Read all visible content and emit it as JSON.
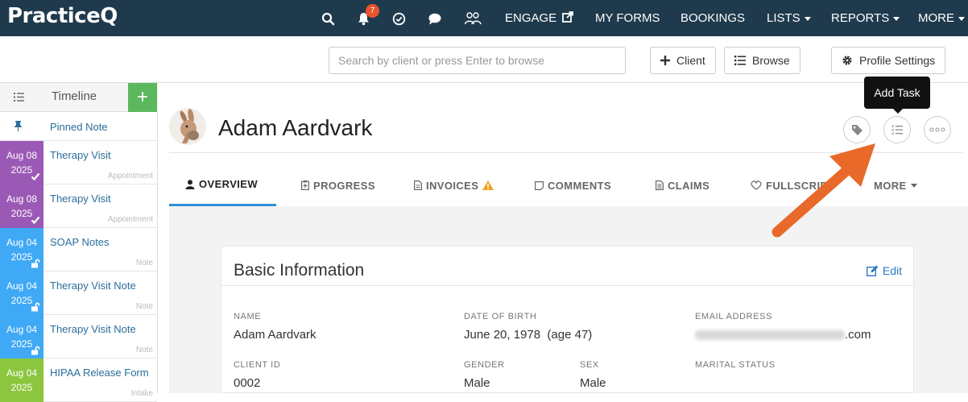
{
  "app": {
    "logo": "PracticeQ"
  },
  "topnav": {
    "notification_count": "7",
    "links": [
      {
        "label": "ENGAGE"
      },
      {
        "label": "MY FORMS"
      },
      {
        "label": "BOOKINGS"
      },
      {
        "label": "LISTS"
      },
      {
        "label": "REPORTS"
      },
      {
        "label": "MORE"
      }
    ]
  },
  "toolbar": {
    "search_placeholder": "Search by client or press Enter to browse",
    "client_button": "Client",
    "browse_button": "Browse",
    "profile_settings_button": "Profile Settings"
  },
  "timeline": {
    "title": "Timeline",
    "pinned": "Pinned Note",
    "items": [
      {
        "month": "Aug 08",
        "year": "2025",
        "label": "Therapy Visit",
        "type": "Appointment",
        "color": "#9b59b6",
        "mark": "check"
      },
      {
        "month": "Aug 08",
        "year": "2025",
        "label": "Therapy Visit",
        "type": "Appointment",
        "color": "#9b59b6",
        "mark": "check"
      },
      {
        "month": "Aug 04",
        "year": "2025",
        "label": "SOAP Notes",
        "type": "Note",
        "color": "#3fa9f5",
        "mark": "unlock"
      },
      {
        "month": "Aug 04",
        "year": "2025",
        "label": "Therapy Visit Note",
        "type": "Note",
        "color": "#3fa9f5",
        "mark": "unlock"
      },
      {
        "month": "Aug 04",
        "year": "2025",
        "label": "Therapy Visit Note",
        "type": "Note",
        "color": "#3fa9f5",
        "mark": "unlock"
      },
      {
        "month": "Aug 04",
        "year": "2025",
        "label": "HIPAA Release Form",
        "type": "Intake",
        "color": "#8cc63f",
        "mark": "none"
      }
    ]
  },
  "client": {
    "name": "Adam Aardvark"
  },
  "tooltip": "Add Task",
  "tabs": [
    {
      "label": "OVERVIEW",
      "icon": "user-icon",
      "active": true
    },
    {
      "label": "PROGRESS",
      "icon": "progress-icon"
    },
    {
      "label": "INVOICES",
      "icon": "invoice-icon",
      "warning": true
    },
    {
      "label": "COMMENTS",
      "icon": "comment-icon"
    },
    {
      "label": "CLAIMS",
      "icon": "claims-icon"
    },
    {
      "label": "FULLSCRIPT",
      "icon": "fullscript-icon"
    },
    {
      "label": "MORE",
      "icon": "caret-icon"
    }
  ],
  "basic_info": {
    "title": "Basic Information",
    "edit": "Edit",
    "fields": {
      "name_label": "NAME",
      "name_value": "Adam Aardvark",
      "dob_label": "DATE OF BIRTH",
      "dob_value": "June 20, 1978  (age 47)",
      "email_label": "EMAIL ADDRESS",
      "email_value": ".com",
      "client_id_label": "CLIENT ID",
      "client_id_value": "0002",
      "gender_label": "GENDER",
      "gender_value": "Male",
      "sex_label": "SEX",
      "sex_value": "Male",
      "marital_label": "MARITAL STATUS"
    }
  },
  "colors": {
    "nav_bg": "#1f3a4d",
    "accent": "#2e91d3",
    "add_green": "#5cb85c",
    "annotation_arrow": "#e8692a"
  }
}
